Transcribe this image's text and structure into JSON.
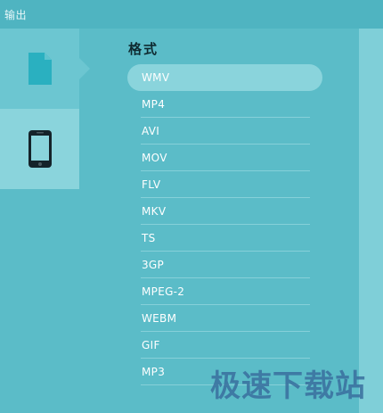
{
  "window": {
    "title": "输出"
  },
  "categories": [
    {
      "name": "file",
      "icon": "document-icon",
      "selected": true
    },
    {
      "name": "device",
      "icon": "phone-icon",
      "selected": false
    }
  ],
  "format_section": {
    "header": "格式",
    "items": [
      {
        "label": "WMV",
        "selected": true
      },
      {
        "label": "MP4"
      },
      {
        "label": "AVI"
      },
      {
        "label": "MOV"
      },
      {
        "label": "FLV"
      },
      {
        "label": "MKV"
      },
      {
        "label": "TS"
      },
      {
        "label": "3GP"
      },
      {
        "label": "MPEG-2"
      },
      {
        "label": "WEBM"
      },
      {
        "label": "GIF"
      },
      {
        "label": "MP3"
      }
    ]
  },
  "watermark": {
    "text": "极速下载站"
  },
  "colors": {
    "background": "#5bbcc8",
    "accent": "#2ab0c0",
    "selected_pill": "#8ad4dc",
    "header_text": "#0e2a30"
  }
}
